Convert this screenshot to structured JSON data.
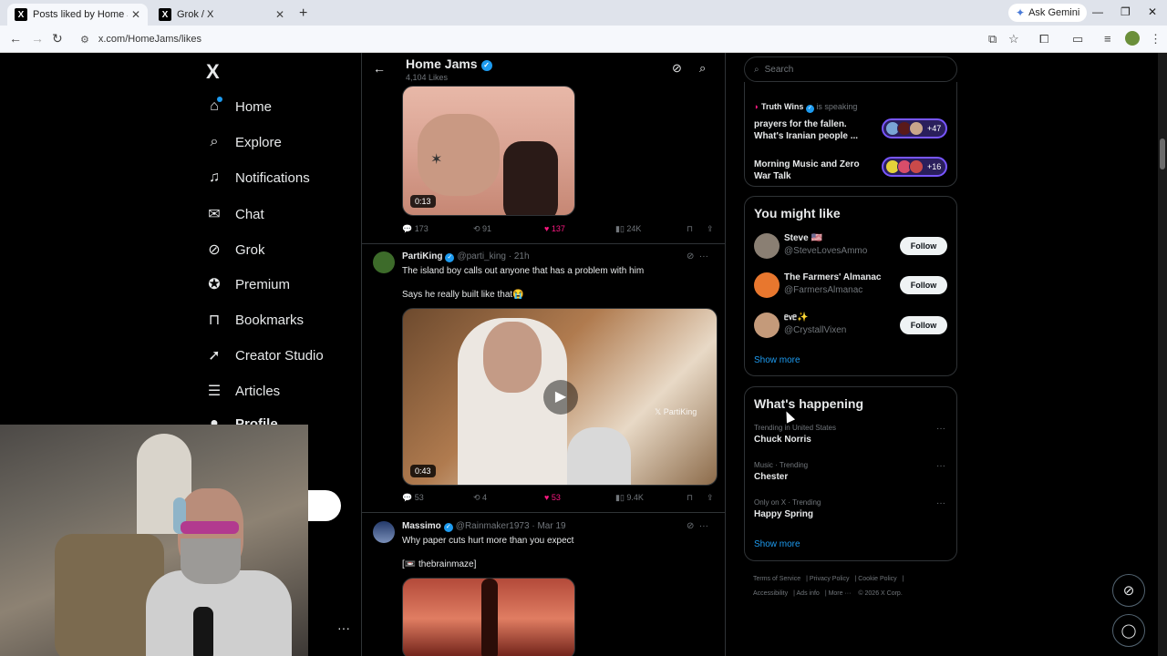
{
  "browser": {
    "tabs": [
      {
        "title": "Posts liked by Home Jams (@H",
        "favicon": "X",
        "active": true
      },
      {
        "title": "Grok / X",
        "favicon": "X",
        "active": false
      }
    ],
    "new_tab": "+",
    "gemini_label": "Ask Gemini",
    "url": "x.com/HomeJams/likes"
  },
  "nav": {
    "logo": "X",
    "items": [
      {
        "label": "Home",
        "icon": "home-icon"
      },
      {
        "label": "Explore",
        "icon": "search-icon"
      },
      {
        "label": "Notifications",
        "icon": "bell-icon"
      },
      {
        "label": "Chat",
        "icon": "mail-icon"
      },
      {
        "label": "Grok",
        "icon": "grok-icon"
      },
      {
        "label": "Premium",
        "icon": "verified-icon"
      },
      {
        "label": "Bookmarks",
        "icon": "bookmark-icon"
      },
      {
        "label": "Creator Studio",
        "icon": "rocket-icon"
      },
      {
        "label": "Articles",
        "icon": "article-icon"
      },
      {
        "label": "Profile",
        "icon": "person-icon"
      }
    ],
    "more": "···"
  },
  "header": {
    "name": "Home Jams",
    "likes": "4,104 Likes"
  },
  "posts": [
    {
      "duration": "0:13",
      "replies": "173",
      "reposts": "91",
      "likes": "137",
      "views": "24K"
    },
    {
      "author": "PartiKing",
      "handle": "@parti_king",
      "time": "21h",
      "text1": "The island boy calls out anyone that has a problem with him",
      "text2": "Says he really built like that😭",
      "duration": "0:43",
      "watermark": "PartiKing",
      "replies": "53",
      "reposts": "4",
      "likes": "53",
      "views": "9.4K"
    },
    {
      "author": "Massimo",
      "handle": "@Rainmaker1973",
      "time": "Mar 19",
      "text1": "Why paper cuts hurt more than you expect",
      "text2": "[📼 thebrainmaze]"
    }
  ],
  "right": {
    "search_placeholder": "Search",
    "spaces": {
      "speaker": "Truth Wins",
      "speaking": "is speaking",
      "items": [
        {
          "title1": "prayers for the fallen.",
          "title2": "What's Iranian people ...",
          "count": "+47"
        },
        {
          "title1": "Morning Music and Zero",
          "title2": "War Talk",
          "count": "+16"
        }
      ]
    },
    "you_might_like": {
      "title": "You might like",
      "accounts": [
        {
          "name": "Steve 🇺🇸",
          "handle": "@SteveLovesAmmo",
          "follow": "Follow"
        },
        {
          "name": "The Farmers' Almanac",
          "handle": "@FarmersAlmanac",
          "follow": "Follow"
        },
        {
          "name": "ᥱ᥎ᥱ✨",
          "handle": "@CrystallVixen",
          "follow": "Follow"
        }
      ],
      "show_more": "Show more"
    },
    "happening": {
      "title": "What's happening",
      "trends": [
        {
          "context": "Trending in United States",
          "topic": "Chuck Norris"
        },
        {
          "context": "Music · Trending",
          "topic": "Chester"
        },
        {
          "context": "Only on X · Trending",
          "topic": "Happy Spring"
        }
      ],
      "show_more": "Show more"
    },
    "footer": {
      "links": [
        "Terms of Service",
        "Privacy Policy",
        "Cookie Policy",
        "Accessibility",
        "Ads info",
        "More ···"
      ],
      "copyright": "© 2026 X Corp."
    }
  }
}
